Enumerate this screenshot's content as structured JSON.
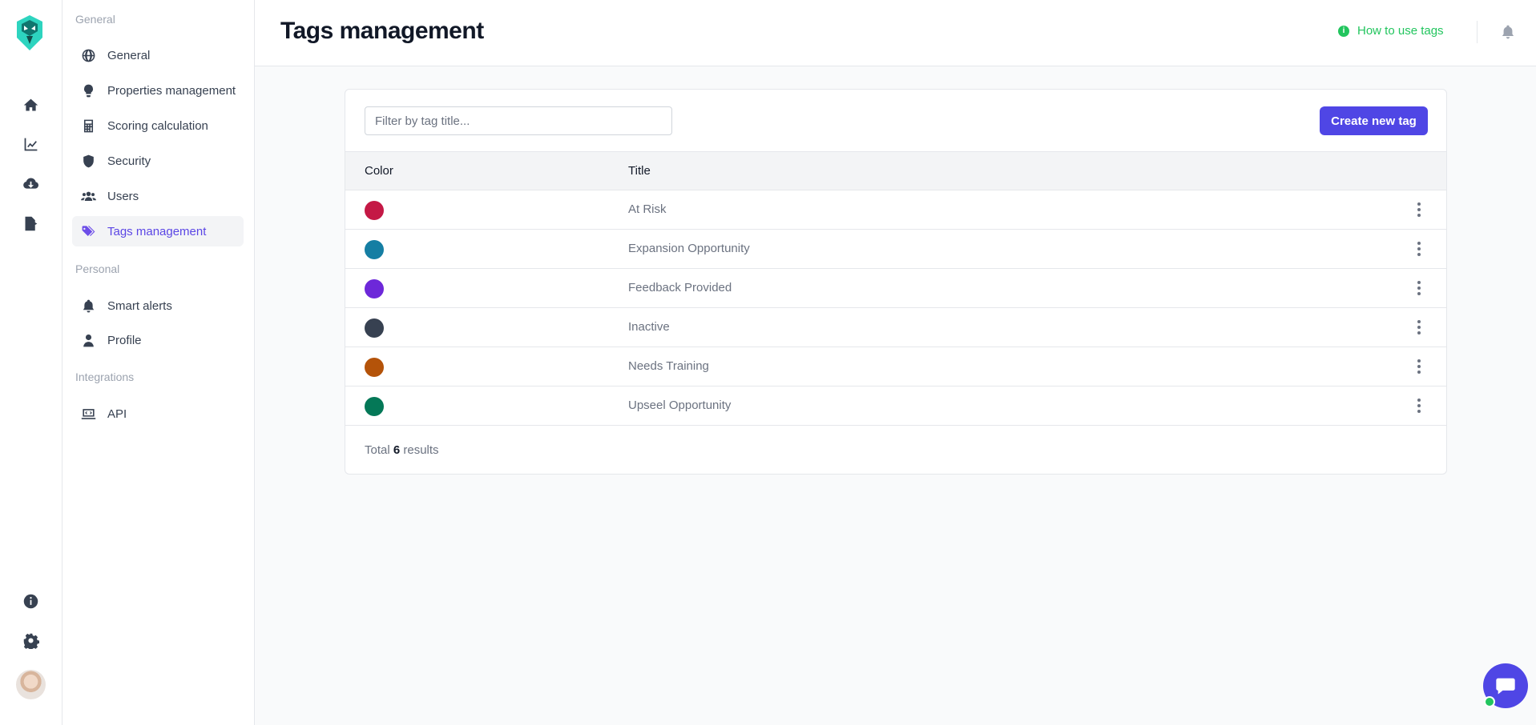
{
  "rail": {
    "items": [
      {
        "name": "home",
        "icon": "home-icon"
      },
      {
        "name": "analytics",
        "icon": "chart-line-icon"
      },
      {
        "name": "import",
        "icon": "cloud-download-icon"
      },
      {
        "name": "export",
        "icon": "file-export-icon"
      }
    ],
    "bottom": [
      {
        "name": "info",
        "icon": "info-icon"
      },
      {
        "name": "settings",
        "icon": "gear-icon"
      }
    ]
  },
  "sidenav": {
    "sections": [
      {
        "title": "General",
        "items": [
          {
            "label": "General",
            "icon": "globe-icon"
          },
          {
            "label": "Properties management",
            "icon": "lightbulb-icon"
          },
          {
            "label": "Scoring calculation",
            "icon": "calculator-icon"
          },
          {
            "label": "Security",
            "icon": "shield-icon"
          },
          {
            "label": "Users",
            "icon": "users-icon"
          },
          {
            "label": "Tags management",
            "icon": "tags-icon",
            "active": true
          }
        ]
      },
      {
        "title": "Personal",
        "items": [
          {
            "label": "Smart alerts",
            "icon": "bell-icon"
          },
          {
            "label": "Profile",
            "icon": "user-icon"
          }
        ]
      },
      {
        "title": "Integrations",
        "items": [
          {
            "label": "API",
            "icon": "api-icon"
          }
        ]
      }
    ]
  },
  "header": {
    "title": "Tags management",
    "help_link": "How to use tags",
    "help_icon_glyph": "i"
  },
  "toolbar": {
    "filter_placeholder": "Filter by tag title...",
    "create_label": "Create new tag"
  },
  "table": {
    "columns": [
      "Color",
      "Title"
    ],
    "rows": [
      {
        "color": "#c41845",
        "title": "At Risk"
      },
      {
        "color": "#157ea3",
        "title": "Expansion Opportunity"
      },
      {
        "color": "#6d28d9",
        "title": "Feedback Provided"
      },
      {
        "color": "#374151",
        "title": "Inactive"
      },
      {
        "color": "#b45309",
        "title": "Needs Training"
      },
      {
        "color": "#047857",
        "title": "Upseel Opportunity"
      }
    ]
  },
  "footer": {
    "total_prefix": "Total",
    "total_count": "6",
    "total_suffix": "results"
  },
  "colors": {
    "accent": "#4f46e5",
    "active_nav": "#5b46e5",
    "help_green": "#22c55e"
  }
}
